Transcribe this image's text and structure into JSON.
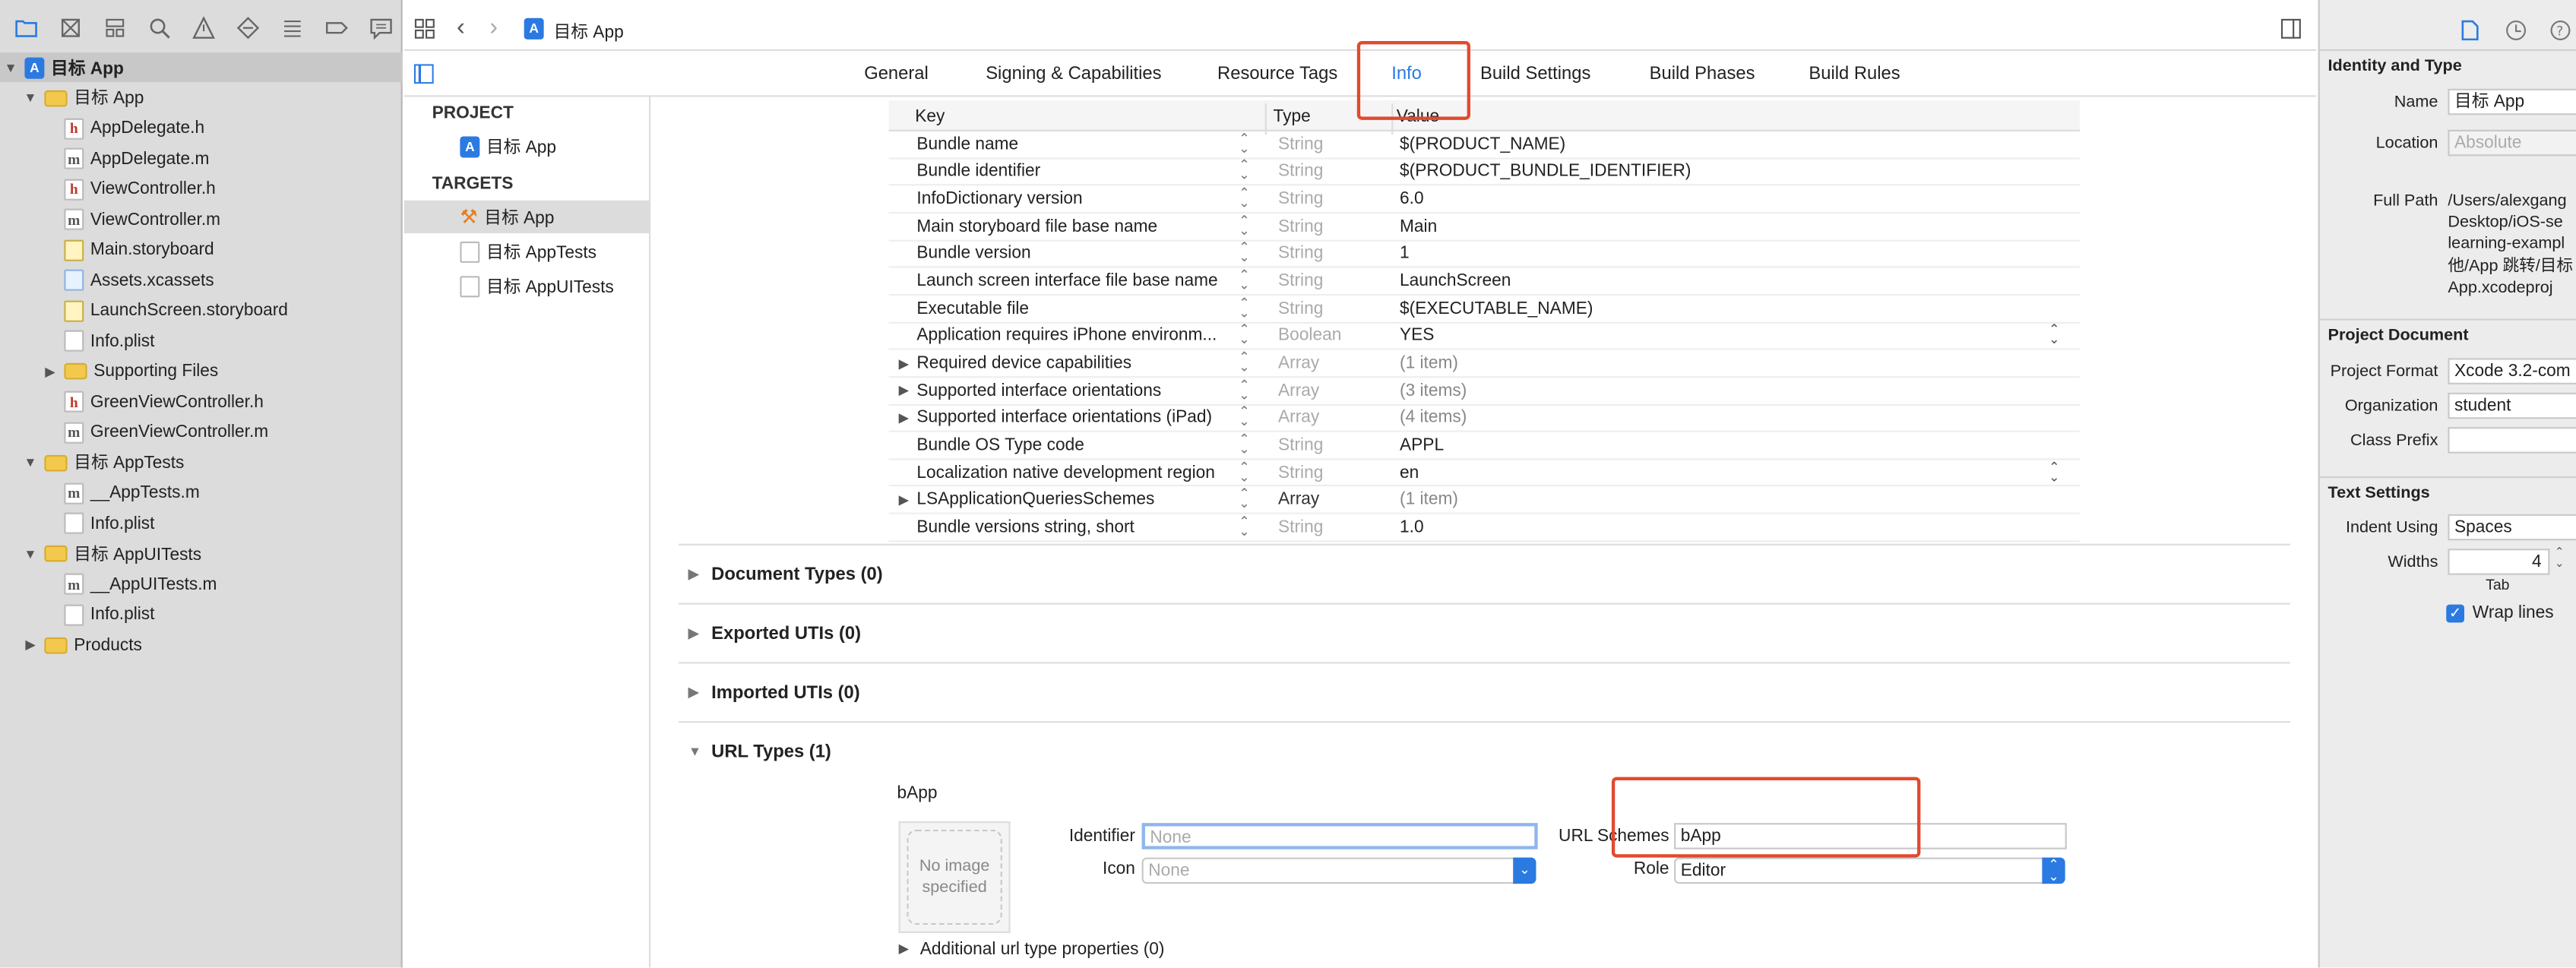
{
  "window": {
    "title": "目标 App"
  },
  "navigator": {
    "tree": [
      {
        "label": "目标 App",
        "kind": "proj",
        "depth": 0,
        "disclosure": "open",
        "bold": true
      },
      {
        "label": "目标 App",
        "kind": "folder",
        "depth": 1,
        "disclosure": "open"
      },
      {
        "label": "AppDelegate.h",
        "kind": "h",
        "depth": 2
      },
      {
        "label": "AppDelegate.m",
        "kind": "m",
        "depth": 2
      },
      {
        "label": "ViewController.h",
        "kind": "h",
        "depth": 2
      },
      {
        "label": "ViewController.m",
        "kind": "m",
        "depth": 2
      },
      {
        "label": "Main.storyboard",
        "kind": "sb",
        "depth": 2
      },
      {
        "label": "Assets.xcassets",
        "kind": "as",
        "depth": 2
      },
      {
        "label": "LaunchScreen.storyboard",
        "kind": "sb",
        "depth": 2
      },
      {
        "label": "Info.plist",
        "kind": "pl",
        "depth": 2
      },
      {
        "label": "Supporting Files",
        "kind": "folder",
        "depth": 2,
        "disclosure": "closed"
      },
      {
        "label": "GreenViewController.h",
        "kind": "h",
        "depth": 2
      },
      {
        "label": "GreenViewController.m",
        "kind": "m",
        "depth": 2
      },
      {
        "label": "目标 AppTests",
        "kind": "folder",
        "depth": 1,
        "disclosure": "open"
      },
      {
        "label": "__AppTests.m",
        "kind": "m",
        "depth": 2
      },
      {
        "label": "Info.plist",
        "kind": "pl",
        "depth": 2
      },
      {
        "label": "目标 AppUITests",
        "kind": "folder",
        "depth": 1,
        "disclosure": "open"
      },
      {
        "label": "__AppUITests.m",
        "kind": "m",
        "depth": 2
      },
      {
        "label": "Info.plist",
        "kind": "pl",
        "depth": 2
      },
      {
        "label": "Products",
        "kind": "folder",
        "depth": 1,
        "disclosure": "closed"
      }
    ]
  },
  "tabs": [
    "General",
    "Signing & Capabilities",
    "Resource Tags",
    "Info",
    "Build Settings",
    "Build Phases",
    "Build Rules"
  ],
  "active_tab": "Info",
  "targets_pane": {
    "project_header": "PROJECT",
    "project": "目标 App",
    "targets_header": "TARGETS",
    "targets": [
      "目标 App",
      "目标 AppTests",
      "目标 AppUITests"
    ]
  },
  "plist": {
    "headers": {
      "key": "Key",
      "type": "Type",
      "value": "Value"
    },
    "rows": [
      {
        "key": "Bundle name",
        "type": "String",
        "value": "$(PRODUCT_NAME)"
      },
      {
        "key": "Bundle identifier",
        "type": "String",
        "value": "$(PRODUCT_BUNDLE_IDENTIFIER)"
      },
      {
        "key": "InfoDictionary version",
        "type": "String",
        "value": "6.0"
      },
      {
        "key": "Main storyboard file base name",
        "type": "String",
        "value": "Main"
      },
      {
        "key": "Bundle version",
        "type": "String",
        "value": "1"
      },
      {
        "key": "Launch screen interface file base name",
        "type": "String",
        "value": "LaunchScreen"
      },
      {
        "key": "Executable file",
        "type": "String",
        "value": "$(EXECUTABLE_NAME)"
      },
      {
        "key": "Application requires iPhone environm...",
        "type": "Boolean",
        "value": "YES",
        "popup": true
      },
      {
        "key": "Required device capabilities",
        "type": "Array",
        "value": "(1 item)",
        "disclosure": true,
        "gray": true
      },
      {
        "key": "Supported interface orientations",
        "type": "Array",
        "value": "(3 items)",
        "disclosure": true,
        "gray": true
      },
      {
        "key": "Supported interface orientations (iPad)",
        "type": "Array",
        "value": "(4 items)",
        "disclosure": true,
        "gray": true
      },
      {
        "key": "Bundle OS Type code",
        "type": "String",
        "value": "APPL"
      },
      {
        "key": "Localization native development region",
        "type": "String",
        "value": "en",
        "popup": true
      },
      {
        "key": "LSApplicationQueriesSchemes",
        "type": "Array",
        "value": "(1 item)",
        "disclosure": true,
        "gray": true,
        "darkType": true
      },
      {
        "key": "Bundle versions string, short",
        "type": "String",
        "value": "1.0"
      }
    ]
  },
  "sections": [
    {
      "label": "Document Types (0)",
      "open": false
    },
    {
      "label": "Exported UTIs (0)",
      "open": false
    },
    {
      "label": "Imported UTIs (0)",
      "open": false
    },
    {
      "label": "URL Types (1)",
      "open": true
    }
  ],
  "url_type": {
    "name": "bApp",
    "image_text": "No image specified",
    "identifier_label": "Identifier",
    "identifier_placeholder": "None",
    "icon_label": "Icon",
    "icon_placeholder": "None",
    "schemes_label": "URL Schemes",
    "schemes_value": "bApp",
    "role_label": "Role",
    "role_value": "Editor",
    "additional": "Additional url type properties (0)"
  },
  "inspector": {
    "identity_header": "Identity and Type",
    "name_label": "Name",
    "name_value": "目标 App",
    "location_label": "Location",
    "location_value": "Absolute",
    "fullpath_label": "Full Path",
    "fullpath_lines": [
      "/Users/alexgang",
      "Desktop/iOS-se",
      "learning-exampl",
      "他/App 跳转/目标",
      "App.xcodeproj"
    ],
    "project_doc_header": "Project Document",
    "format_label": "Project Format",
    "format_value": "Xcode 3.2-com",
    "org_label": "Organization",
    "org_value": "student",
    "prefix_label": "Class Prefix",
    "prefix_value": "",
    "text_header": "Text Settings",
    "indent_label": "Indent Using",
    "indent_value": "Spaces",
    "widths_label": "Widths",
    "widths_value": "4",
    "tab_label": "Tab",
    "wrap_label": "Wrap lines"
  },
  "colors": {
    "accent": "#2a7ae2",
    "highlight": "#e24a2e",
    "navigator_bg": "#dcdcdc"
  }
}
